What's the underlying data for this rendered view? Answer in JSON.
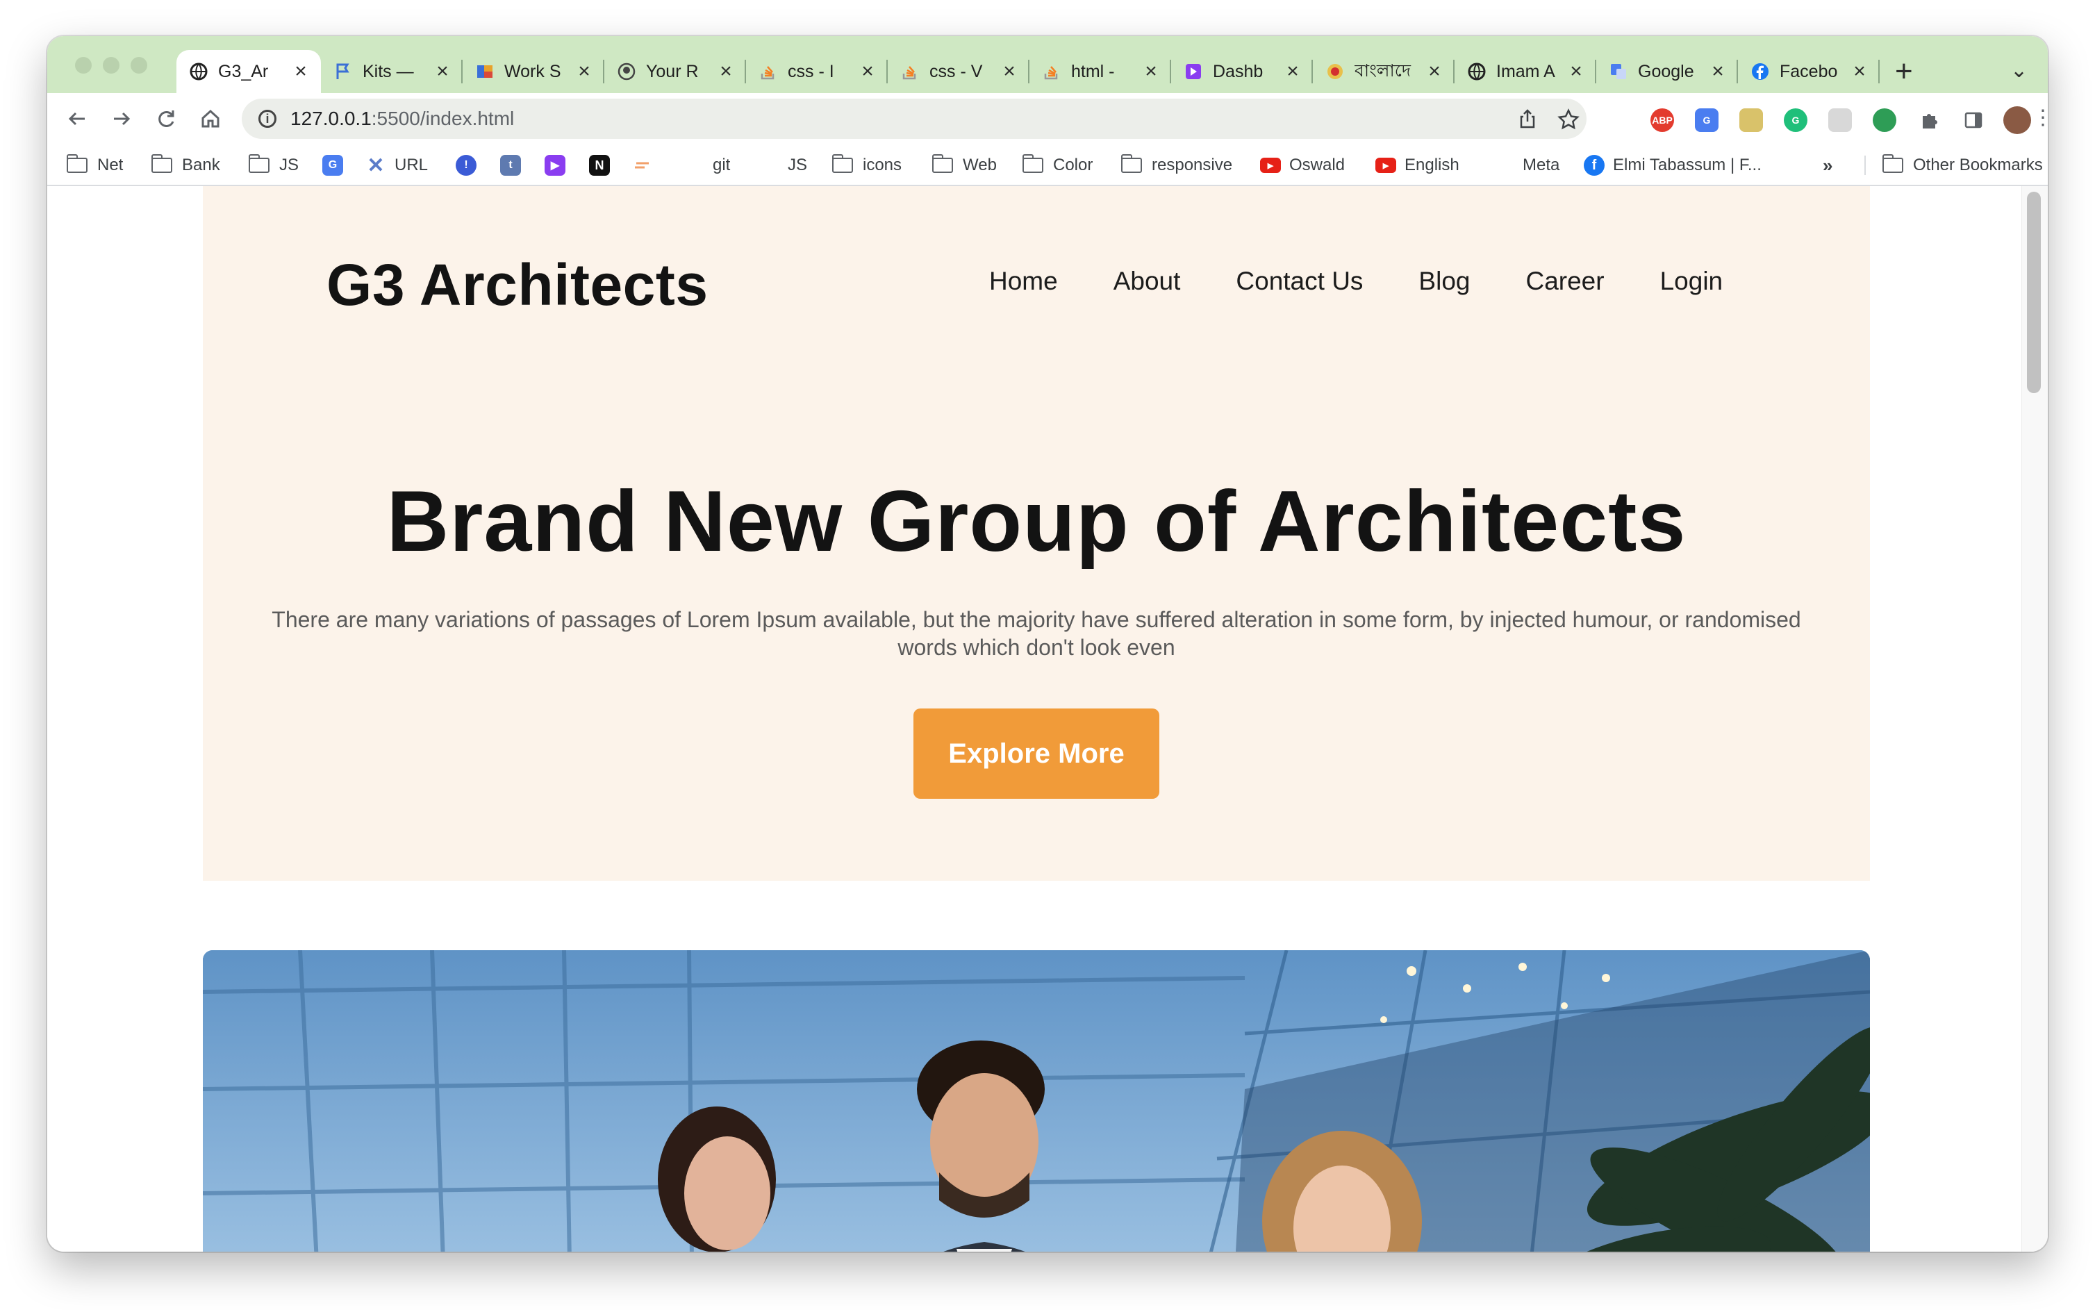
{
  "browser": {
    "tabs": [
      {
        "title": "G3_Ar",
        "favicon": "globe-icon",
        "active": true
      },
      {
        "title": "Kits —",
        "favicon": "flag-icon",
        "active": false
      },
      {
        "title": "Work S",
        "favicon": "work-icon",
        "active": false
      },
      {
        "title": "Your R",
        "favicon": "github-icon",
        "active": false
      },
      {
        "title": "css - I",
        "favicon": "stackoverflow-icon",
        "active": false
      },
      {
        "title": "css - V",
        "favicon": "stackoverflow-icon",
        "active": false
      },
      {
        "title": "html -",
        "favicon": "stackoverflow-icon",
        "active": false
      },
      {
        "title": "Dashb",
        "favicon": "dashboard-icon",
        "active": false
      },
      {
        "title": "বাংলাদে",
        "favicon": "bd-icon",
        "active": false
      },
      {
        "title": "Imam A",
        "favicon": "globe-icon",
        "active": false
      },
      {
        "title": "Google",
        "favicon": "translate-icon",
        "active": false
      },
      {
        "title": "Facebo",
        "favicon": "facebook-icon",
        "active": false
      }
    ],
    "url_host": "127.0.0.1",
    "url_path": ":5500/index.html",
    "extensions": [
      {
        "name": "adblock-icon",
        "label": "ABP",
        "color": "#e33b2e"
      },
      {
        "name": "translate-ext-icon",
        "label": "G",
        "color": "#4a7df0"
      },
      {
        "name": "notes-ext-icon",
        "label": "",
        "color": "#d9c26a"
      },
      {
        "name": "grammarly-icon",
        "label": "G",
        "color": "#1fbf7a"
      },
      {
        "name": "grid-ext-icon",
        "label": "",
        "color": "#d8d8d8"
      },
      {
        "name": "android-ext-icon",
        "label": "",
        "color": "#2e9d56"
      }
    ],
    "bookmarks": [
      {
        "label": "Net",
        "type": "folder"
      },
      {
        "label": "Bank",
        "type": "folder"
      },
      {
        "label": "JS",
        "type": "folder"
      },
      {
        "label": "",
        "type": "translate"
      },
      {
        "label": "URL",
        "type": "link"
      },
      {
        "label": "",
        "type": "app-blue"
      },
      {
        "label": "",
        "type": "app-tumblr"
      },
      {
        "label": "",
        "type": "app-purple"
      },
      {
        "label": "",
        "type": "notion"
      },
      {
        "label": "",
        "type": "app-line"
      },
      {
        "label": "git",
        "type": "plain"
      },
      {
        "label": "JS",
        "type": "plain"
      },
      {
        "label": "icons",
        "type": "folder"
      },
      {
        "label": "Web",
        "type": "folder"
      },
      {
        "label": "Color",
        "type": "folder"
      },
      {
        "label": "responsive",
        "type": "folder"
      },
      {
        "label": "Oswald",
        "type": "youtube"
      },
      {
        "label": "English",
        "type": "youtube"
      },
      {
        "label": "Meta",
        "type": "plain"
      },
      {
        "label": "Elmi Tabassum | F...",
        "type": "facebook"
      }
    ],
    "bookmarks_overflow": "»",
    "other_bookmarks": "Other Bookmarks"
  },
  "site": {
    "logo": "G3 Architects",
    "nav": [
      "Home",
      "About",
      "Contact Us",
      "Blog",
      "Career",
      "Login"
    ],
    "hero_title": "Brand New Group of Architects",
    "hero_subtitle": "There are many variations of passages of Lorem Ipsum available, but the majority have suffered alteration in some form, by injected humour, or randomised words which don't look even",
    "cta_label": "Explore More",
    "colors": {
      "hero_bg": "#fcf3ea",
      "cta": "#f19b39",
      "text": "#131313"
    },
    "hero_image": "team-photo"
  }
}
